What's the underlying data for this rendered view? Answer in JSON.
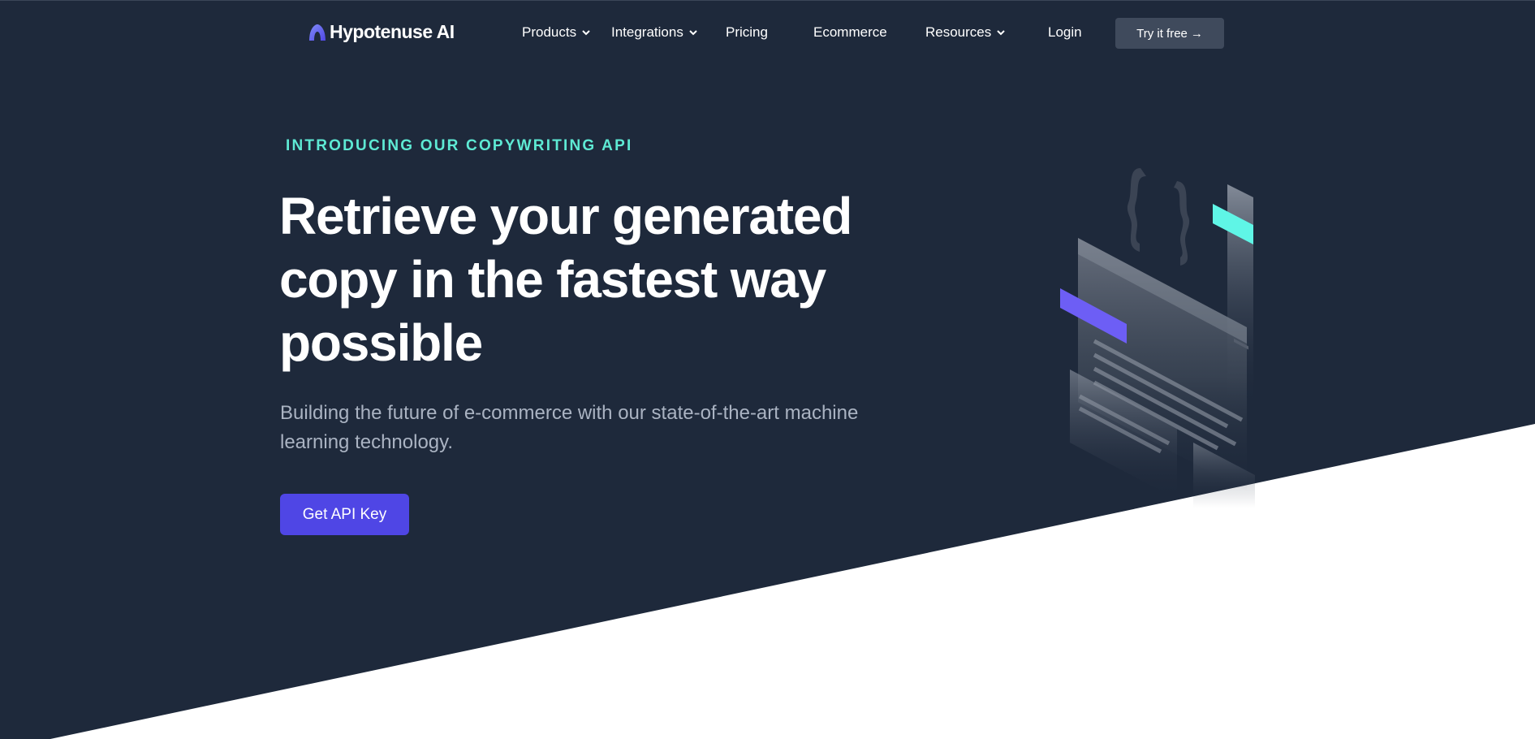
{
  "brand": {
    "name": "Hypotenuse AI",
    "logo_icon": "arch-logo-icon",
    "accent": "#6366f1"
  },
  "nav": {
    "items": [
      {
        "label": "Products",
        "dropdown": true
      },
      {
        "label": "Integrations",
        "dropdown": true
      },
      {
        "label": "Pricing",
        "dropdown": false
      },
      {
        "label": "Ecommerce",
        "dropdown": false
      },
      {
        "label": "Resources",
        "dropdown": true
      },
      {
        "label": "Login",
        "dropdown": false
      }
    ],
    "cta_label": "Try it free",
    "cta_arrow": "→"
  },
  "hero": {
    "eyebrow": "INTRODUCING OUR COPYWRITING API",
    "headline": "Retrieve your generated copy in the fastest way possible",
    "subtext": "Building the future of e-commerce with our state-of-the-art machine learning technology.",
    "button_label": "Get API Key"
  },
  "colors": {
    "background": "#1e293b",
    "eyebrow": "#5eead4",
    "button": "#4f46e5",
    "nav_cta": "#3f4a5c",
    "subtext": "#aab3c2"
  }
}
